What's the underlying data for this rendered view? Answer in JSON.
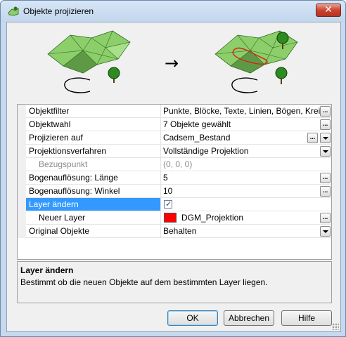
{
  "window": {
    "title": "Objekte projizieren",
    "close_label": "✕"
  },
  "illustration": {
    "arrow": "→",
    "left_icon": "terrain-before-icon",
    "right_icon": "terrain-projected-icon"
  },
  "properties": [
    {
      "label": "Objektfilter",
      "value": "Punkte, Blöcke, Texte, Linien, Bögen, Kreis",
      "control": "ellipsis"
    },
    {
      "label": "Objektwahl",
      "value": "7 Objekte gewählt",
      "control": "ellipsis"
    },
    {
      "label": "Projizieren auf",
      "value": "Cadsem_Bestand",
      "control": "ellipsis-dropdown"
    },
    {
      "label": "Projektionsverfahren",
      "value": "Vollständige Projektion",
      "control": "dropdown"
    },
    {
      "label": "Bezugspunkt",
      "value": "(0, 0, 0)",
      "control": "none",
      "disabled": true,
      "sub": true
    },
    {
      "label": "Bogenauflösung: Länge",
      "value": "5",
      "control": "ellipsis"
    },
    {
      "label": "Bogenauflösung: Winkel",
      "value": "10",
      "control": "ellipsis"
    },
    {
      "label": "Layer ändern",
      "value": "",
      "control": "checkbox",
      "checked": true,
      "selected": true
    },
    {
      "label": "Neuer Layer",
      "value": "DGM_Projektion",
      "control": "ellipsis",
      "swatch": "#ff0000",
      "sub": true
    },
    {
      "label": "Original Objekte",
      "value": "Behalten",
      "control": "dropdown"
    }
  ],
  "ellipsis_label": "...",
  "checkbox_mark": "✓",
  "description": {
    "title": "Layer ändern",
    "text": "Bestimmt ob die neuen Objekte auf dem bestimmten Layer liegen."
  },
  "buttons": {
    "ok": "OK",
    "cancel": "Abbrechen",
    "help": "Hilfe"
  },
  "colors": {
    "terrain": "#8ccf6a",
    "terrain_dark": "#3f7a2f",
    "selection": "#3399ff",
    "projected_line": "#d42a1a"
  }
}
